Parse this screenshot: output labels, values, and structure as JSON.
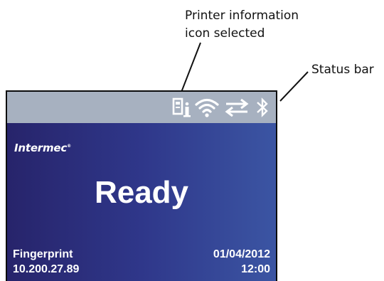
{
  "callouts": {
    "printer_info": [
      "Printer information",
      "icon selected"
    ],
    "status_bar": "Status bar"
  },
  "screen": {
    "status_bar": {
      "icons": [
        "printer-information-icon",
        "wifi-icon",
        "connection-arrows-icon",
        "bluetooth-icon"
      ]
    },
    "brand": "Intermec",
    "brand_mark": "®",
    "status_text": "Ready",
    "footer": {
      "app_name": "Fingerprint",
      "ip_address": "10.200.27.89",
      "date": "01/04/2012",
      "time": "12:00"
    }
  },
  "colors": {
    "status_bar_bg": "#a7b1c0",
    "screen_gradient_start": "#27246b",
    "screen_gradient_end": "#3b55a3",
    "text": "#ffffff"
  }
}
